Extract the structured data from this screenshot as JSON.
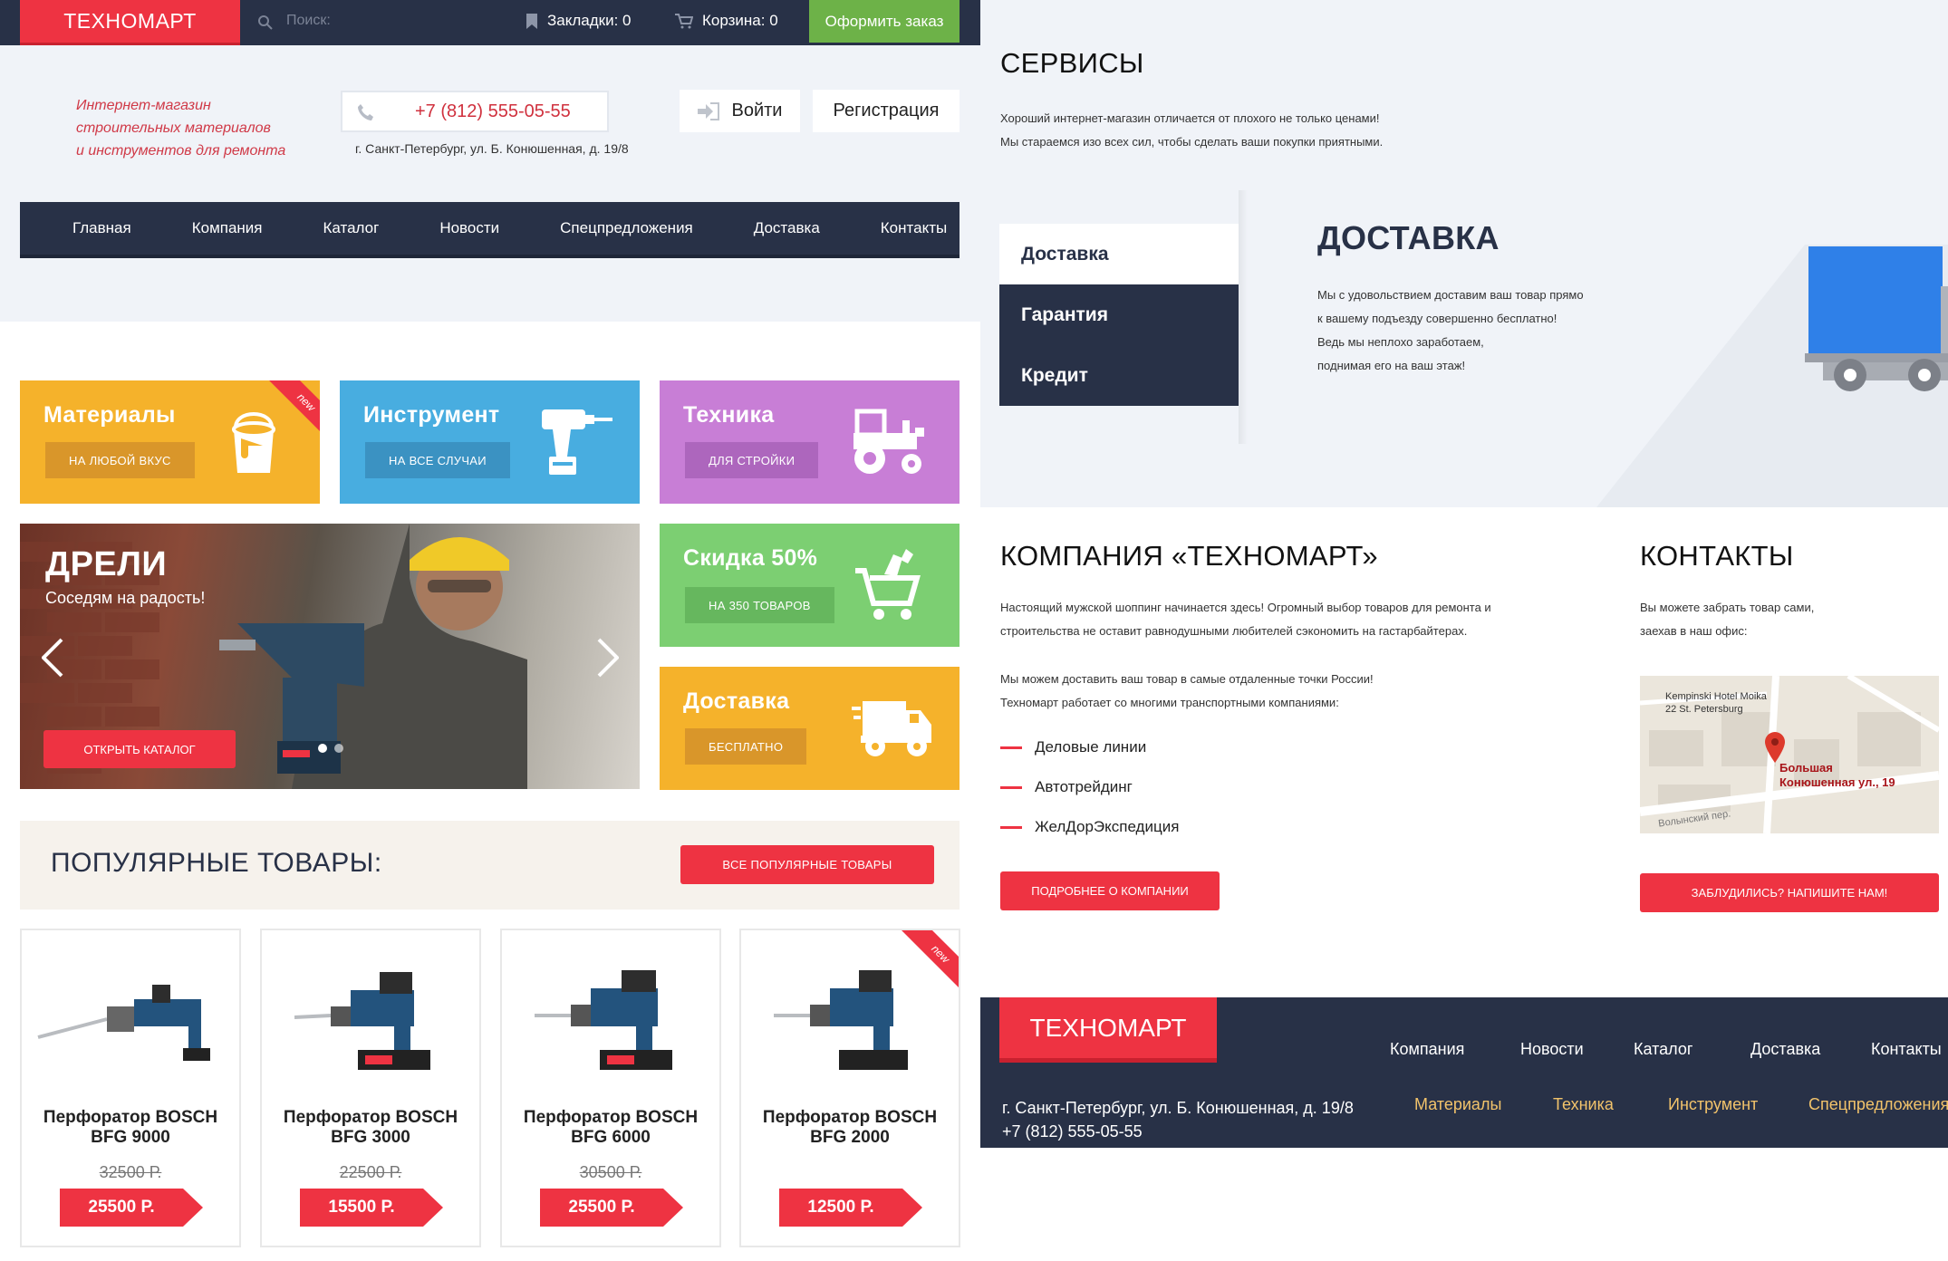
{
  "topbar": {
    "logo": "ТЕХНОМАРТ",
    "search_placeholder": "Поиск:",
    "bookmarks": "Закладки: 0",
    "cart": "Корзина: 0",
    "order_button": "Оформить заказ"
  },
  "header": {
    "tagline": [
      "Интернет-магазин",
      "строительных материалов",
      "и инструментов для ремонта"
    ],
    "phone": "+7 (812) 555-05-55",
    "address": "г. Санкт-Петербург, ул. Б. Конюшенная, д. 19/8",
    "login": "Войти",
    "register": "Регистрация"
  },
  "nav": [
    "Главная",
    "Компания",
    "Каталог",
    "Новости",
    "Спецпредложения",
    "Доставка",
    "Контакты"
  ],
  "tiles": [
    {
      "title": "Материалы",
      "button": "НА ЛЮБОЙ ВКУС",
      "color": "#f5b22b",
      "btn_color": "#d9962a",
      "icon": "paint-bucket-icon",
      "ribbon": "new"
    },
    {
      "title": "Инструмент",
      "button": "НА ВСЕ СЛУЧАИ",
      "color": "#48ade0",
      "btn_color": "#3b92c2",
      "icon": "drill-icon"
    },
    {
      "title": "Техника",
      "button": "ДЛЯ СТРОЙКИ",
      "color": "#c87ed6",
      "btn_color": "#ad66bd",
      "icon": "tractor-icon"
    },
    {
      "title": "Скидка 50%",
      "button": "НА 350 ТОВАРОВ",
      "color": "#7ccf72",
      "btn_color": "#66b75e",
      "icon": "shopping-cart-icon"
    },
    {
      "title": "Доставка",
      "button": "БЕСПЛАТНО",
      "color": "#f5b22b",
      "btn_color": "#d9962a",
      "icon": "delivery-truck-icon"
    }
  ],
  "slider": {
    "title": "ДРЕЛИ",
    "subtitle": "Соседям на радость!",
    "button": "ОТКРЫТЬ КАТАЛОГ"
  },
  "popular": {
    "title": "ПОПУЛЯРНЫЕ ТОВАРЫ:",
    "button": "ВСЕ ПОПУЛЯРНЫЕ ТОВАРЫ",
    "products": [
      {
        "name1": "Перфоратор BOSCH",
        "name2": "BFG 9000",
        "old_price": "32500 Р.",
        "price": "25500 Р."
      },
      {
        "name1": "Перфоратор BOSCH",
        "name2": "BFG 3000",
        "old_price": "22500 Р.",
        "price": "15500 Р."
      },
      {
        "name1": "Перфоратор BOSCH",
        "name2": "BFG 6000",
        "old_price": "30500 Р.",
        "price": "25500 Р."
      },
      {
        "name1": "Перфоратор BOSCH",
        "name2": "BFG 2000",
        "old_price": "",
        "price": "12500 Р.",
        "ribbon": "new"
      }
    ]
  },
  "services": {
    "title": "СЕРВИСЫ",
    "intro": [
      "Хороший интернет-магазин отличается от плохого не только ценами!",
      "Мы стараемся изо всех сил, чтобы сделать ваши покупки приятными."
    ],
    "tabs": [
      "Доставка",
      "Гарантия",
      "Кредит"
    ],
    "active_title": "ДОСТАВКА",
    "active_text": [
      "Мы с удовольствием доставим ваш товар прямо",
      "к вашему подъезду совершенно бесплатно!",
      "Ведь мы неплохо заработаем,",
      "поднимая его на ваш этаж!"
    ]
  },
  "company": {
    "title": "КОМПАНИЯ «ТЕХНОМАРТ»",
    "p1": [
      "Настоящий мужской шоппинг начинается здесь! Огромный выбор товаров для ремонта и",
      "строительства не оставит равнодушными любителей сэкономить на гастарбайтерах."
    ],
    "p2": [
      "Мы можем доставить ваш товар в самые отдаленные точки России!",
      "Техномарт работает со многими транспортными компаниями:"
    ],
    "list": [
      "Деловые линии",
      "Автотрейдинг",
      "ЖелДорЭкспедиция"
    ],
    "button": "ПОДРОБНЕЕ О КОМПАНИИ"
  },
  "contacts": {
    "title": "КОНТАКТЫ",
    "text": [
      "Вы можете забрать товар сами,",
      "заехав в наш офис:"
    ],
    "map_hotel": [
      "Kempinski Hotel Moika",
      "22 St. Petersburg"
    ],
    "map_marker": [
      "Большая",
      "Конюшенная ул., 19"
    ],
    "map_street": "Волынский пер.",
    "button": "ЗАБЛУДИЛИСЬ? НАПИШИТЕ НАМ!"
  },
  "footer": {
    "logo": "ТЕХНОМАРТ",
    "nav": [
      "Компания",
      "Новости",
      "Каталог",
      "Доставка",
      "Контакты"
    ],
    "categories": [
      "Материалы",
      "Техника",
      "Инструмент",
      "Спецпредложения"
    ],
    "address": "г. Санкт-Петербург, ул. Б. Конюшенная, д. 19/8",
    "phone": "+7 (812) 555-05-55"
  }
}
